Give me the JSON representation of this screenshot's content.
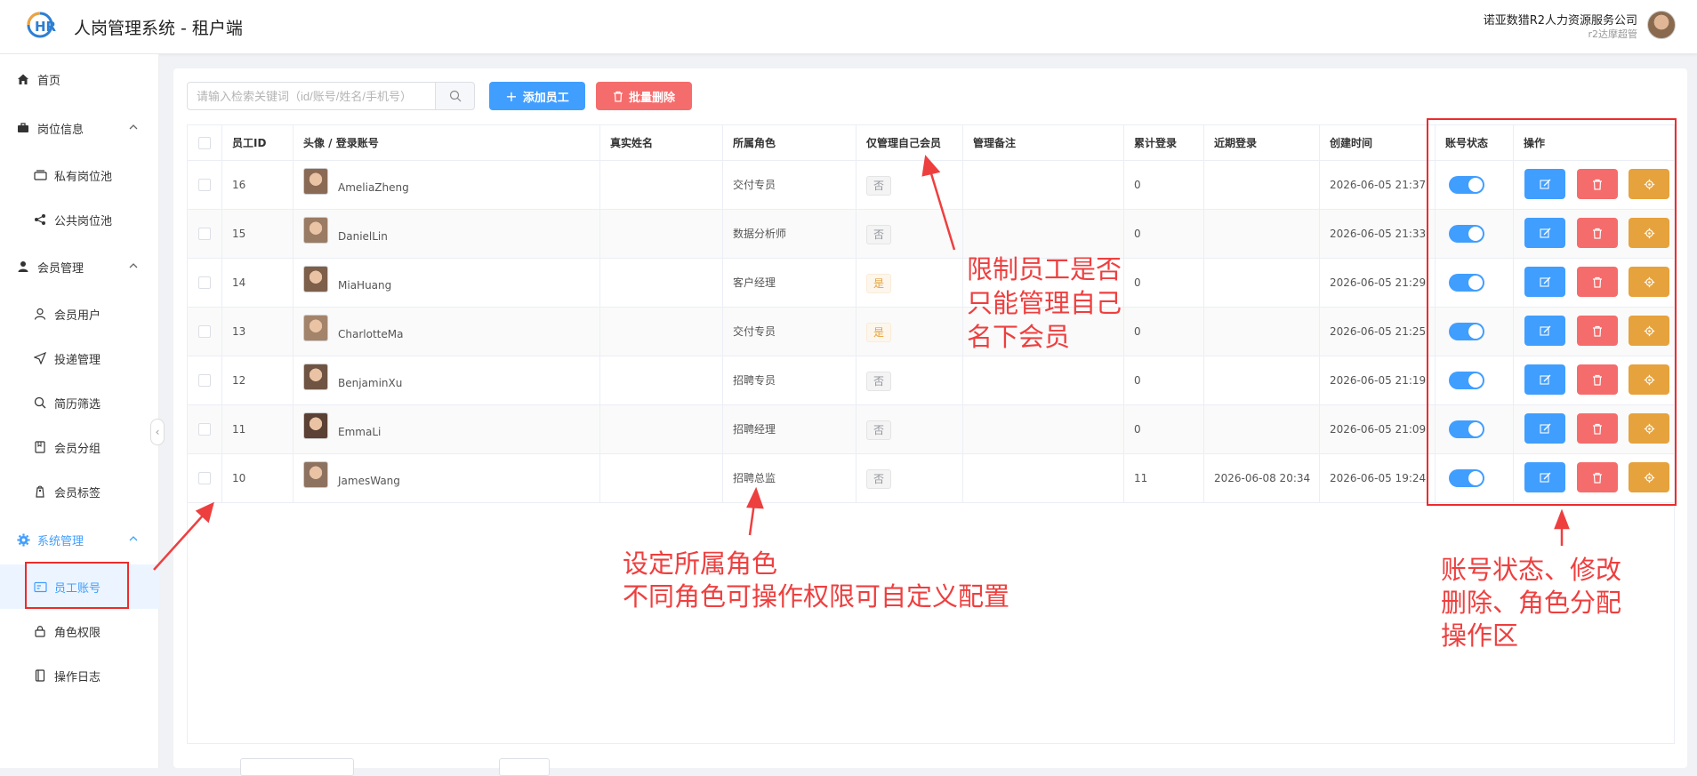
{
  "header": {
    "logo_text": "HR",
    "title": "人岗管理系统 - 租户端",
    "company": "诺亚数猎R2人力资源服务公司",
    "user_role": "r2达摩超管"
  },
  "sidebar": {
    "items": [
      {
        "label": "首页",
        "icon": "home-icon",
        "level": "top"
      },
      {
        "label": "岗位信息",
        "icon": "briefcase-icon",
        "level": "top",
        "expanded": true
      },
      {
        "label": "私有岗位池",
        "icon": "folder-icon",
        "level": "sub"
      },
      {
        "label": "公共岗位池",
        "icon": "share-icon",
        "level": "sub"
      },
      {
        "label": "会员管理",
        "icon": "user-icon",
        "level": "top",
        "expanded": true
      },
      {
        "label": "会员用户",
        "icon": "user-outline-icon",
        "level": "sub"
      },
      {
        "label": "投递管理",
        "icon": "send-icon",
        "level": "sub"
      },
      {
        "label": "简历筛选",
        "icon": "search-icon",
        "level": "sub"
      },
      {
        "label": "会员分组",
        "icon": "book-icon",
        "level": "sub"
      },
      {
        "label": "会员标签",
        "icon": "tag-icon",
        "level": "sub"
      },
      {
        "label": "系统管理",
        "icon": "gear-icon",
        "level": "top",
        "expanded": true,
        "active": true
      },
      {
        "label": "员工账号",
        "icon": "id-card-icon",
        "level": "sub",
        "active": true
      },
      {
        "label": "角色权限",
        "icon": "lock-icon",
        "level": "sub"
      },
      {
        "label": "操作日志",
        "icon": "notebook-icon",
        "level": "sub"
      }
    ]
  },
  "toolbar": {
    "search_placeholder": "请输入检索关键词（id/账号/姓名/手机号）",
    "add_label": "添加员工",
    "batch_delete_label": "批量删除"
  },
  "table": {
    "columns": [
      "员工ID",
      "头像 / 登录账号",
      "真实姓名",
      "所属角色",
      "仅管理自己会员",
      "管理备注",
      "累计登录",
      "近期登录",
      "创建时间",
      "账号状态",
      "操作"
    ],
    "rows": [
      {
        "id": "16",
        "account": "AmeliaZheng",
        "real_name": "",
        "role": "交付专员",
        "own_only": "否",
        "note": "",
        "logins": "0",
        "recent": "",
        "created": "2026-06-05 21:37",
        "enabled": true
      },
      {
        "id": "15",
        "account": "DanielLin",
        "real_name": "",
        "role": "数据分析师",
        "own_only": "否",
        "note": "",
        "logins": "0",
        "recent": "",
        "created": "2026-06-05 21:33",
        "enabled": true
      },
      {
        "id": "14",
        "account": "MiaHuang",
        "real_name": "",
        "role": "客户经理",
        "own_only": "是",
        "note": "",
        "logins": "0",
        "recent": "",
        "created": "2026-06-05 21:29",
        "enabled": true
      },
      {
        "id": "13",
        "account": "CharlotteMa",
        "real_name": "",
        "role": "交付专员",
        "own_only": "是",
        "note": "",
        "logins": "0",
        "recent": "",
        "created": "2026-06-05 21:25",
        "enabled": true
      },
      {
        "id": "12",
        "account": "BenjaminXu",
        "real_name": "",
        "role": "招聘专员",
        "own_only": "否",
        "note": "",
        "logins": "0",
        "recent": "",
        "created": "2026-06-05 21:19",
        "enabled": true
      },
      {
        "id": "11",
        "account": "EmmaLi",
        "real_name": "",
        "role": "招聘经理",
        "own_only": "否",
        "note": "",
        "logins": "0",
        "recent": "",
        "created": "2026-06-05 21:09",
        "enabled": true
      },
      {
        "id": "10",
        "account": "JamesWang",
        "real_name": "",
        "role": "招聘总监",
        "own_only": "否",
        "note": "",
        "logins": "11",
        "recent": "2026-06-08 20:34",
        "created": "2026-06-05 19:24",
        "enabled": true
      }
    ]
  },
  "annotations": {
    "own_members": [
      "限制员工是否",
      "只能管理自己",
      "名下会员"
    ],
    "role": [
      "设定所属角色",
      "不同角色可操作权限可自定义配置"
    ],
    "ops": [
      "账号状态、修改",
      "删除、角色分配",
      "操作区"
    ]
  },
  "colors": {
    "primary": "#409eff",
    "danger": "#f56c6c",
    "warning": "#e6a23c",
    "annotation": "#ee3f3f"
  }
}
